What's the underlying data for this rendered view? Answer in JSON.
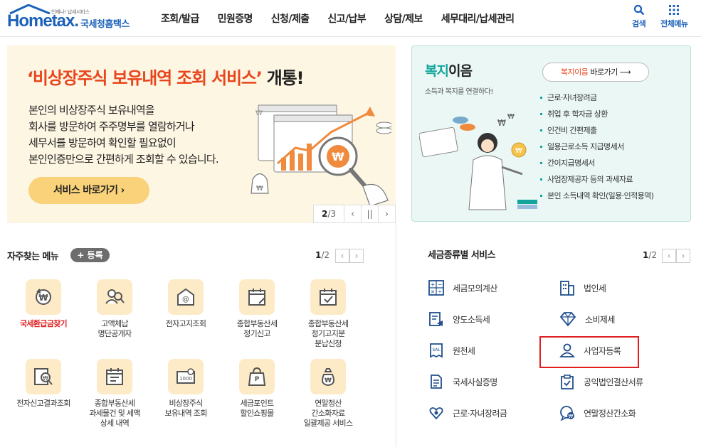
{
  "header": {
    "logo_tag": "언제나! 납세서비스",
    "logo_text": "Hometax.",
    "logo_name": "국세청홈택스",
    "nav": [
      "조회/발급",
      "민원증명",
      "신청/제출",
      "신고/납부",
      "상담/제보",
      "세무대리/납세관리"
    ],
    "search_label": "검색",
    "all_menu_label": "전체메뉴"
  },
  "banner1": {
    "title_main": "‘비상장주식 보유내역 조회 서비스’",
    "title_tail": " 개통!",
    "desc_lines": [
      "본인의 비상장주식 보유내역을",
      "회사를 방문하여 주주명부를 열람하거나",
      "세무서를 방문하여 확인할 필요없이",
      "본인인증만으로 간편하게 조회할 수 있습니다."
    ],
    "button": "서비스 바로가기 ›",
    "pager_current": "2",
    "pager_total": "/3",
    "prev": "‹",
    "pause": "||",
    "next": "›"
  },
  "banner2": {
    "title_a": "복지",
    "title_b": "이음",
    "subtitle": "소득과 복지를 연결하다!",
    "button_a": "복지이음",
    "button_b": " 바로가기 ⟶",
    "list": [
      "근로·자녀장려금",
      "취업 후 학자금 상환",
      "인건비 간편제출",
      "일용근로소득 지급명세서",
      "간이지급명세서",
      "사업장제공자 등의 과세자료",
      "본인 소득내역 확인(일용·인적용역)"
    ]
  },
  "frequent": {
    "title": "자주찾는 메뉴",
    "register": "+ 등록",
    "page_current": "1",
    "page_total": "/2",
    "prev": "‹",
    "next": "›",
    "items": [
      {
        "lines": [
          "국세환급금찾기"
        ],
        "icon": "refund-coin-icon"
      },
      {
        "lines": [
          "고액체납",
          "명단공개자"
        ],
        "icon": "people-search-icon"
      },
      {
        "lines": [
          "전자고지조회"
        ],
        "icon": "email-notice-icon"
      },
      {
        "lines": [
          "종합부동산세",
          "정기신고"
        ],
        "icon": "calendar-icon"
      },
      {
        "lines": [
          "종합부동산세",
          "정기고지분",
          "분납신청"
        ],
        "icon": "calendar-check-icon"
      },
      {
        "lines": [
          "전자신고결과조회"
        ],
        "icon": "won-search-icon"
      },
      {
        "lines": [
          "종합부동산세",
          "과세물건 및 세액",
          "상세 내역"
        ],
        "icon": "calendar-edit-icon"
      },
      {
        "lines": [
          "비상장주식",
          "보유내역 조회"
        ],
        "icon": "stock-certificate-icon"
      },
      {
        "lines": [
          "세금포인트",
          "할인쇼핑몰"
        ],
        "icon": "shopping-bag-icon"
      },
      {
        "lines": [
          "연말정산",
          "간소화자료",
          "일괄제공 서비스"
        ],
        "icon": "money-bag-icon"
      }
    ]
  },
  "taxservice": {
    "title": "세금종류별 서비스",
    "page_current": "1",
    "page_total": "/2",
    "prev": "‹",
    "next": "›",
    "items": [
      {
        "label": "세금모의계산",
        "icon": "calculator-icon"
      },
      {
        "label": "법인세",
        "icon": "building-icon"
      },
      {
        "label": "양도소득세",
        "icon": "document-transfer-icon"
      },
      {
        "label": "소비제세",
        "icon": "diamond-icon"
      },
      {
        "label": "원천세",
        "icon": "receipt-icon"
      },
      {
        "label": "사업자등록",
        "icon": "person-card-icon"
      },
      {
        "label": "국세사실증명",
        "icon": "certificate-icon"
      },
      {
        "label": "공익법인결산서류",
        "icon": "clipboard-icon"
      },
      {
        "label": "근로·자녀장려금",
        "icon": "heart-hand-icon"
      },
      {
        "label": "연말정산간소화",
        "icon": "chat-won-icon"
      }
    ]
  }
}
